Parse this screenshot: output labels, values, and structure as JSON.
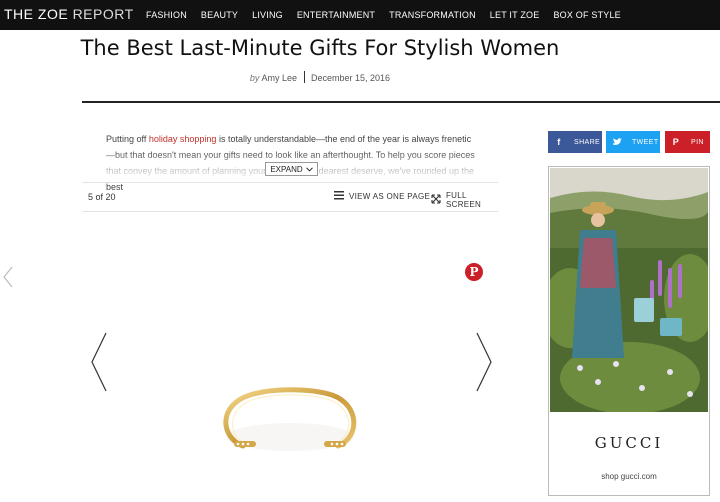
{
  "site": {
    "logo_main": "THE ZOE",
    "logo_sub": "REPORT"
  },
  "nav": {
    "items": [
      "FASHION",
      "BEAUTY",
      "LIVING",
      "ENTERTAINMENT",
      "TRANSFORMATION",
      "LET IT ZOE",
      "BOX OF STYLE"
    ]
  },
  "article": {
    "title": "The Best Last-Minute Gifts For Stylish Women",
    "by": "by",
    "author": "Amy Lee",
    "date": "December 15, 2016",
    "intro_before": "Putting off ",
    "intro_link": "holiday shopping",
    "intro_after": " is totally understandable—the end of the year is always frenetic—but that doesn't mean your gifts need to look like an afterthought. To help you score pieces that convey the amount of planning your nearest and dearest deserve, we've rounded up the best",
    "expand_label": "EXPAND"
  },
  "gallery": {
    "counter": "5 of 20",
    "view_one_page": "VIEW AS ONE PAGE",
    "full_screen": "FULL SCREEN"
  },
  "share": {
    "facebook": "SHARE",
    "twitter": "TWEET",
    "pinterest": "PIN"
  },
  "ad": {
    "brand": "GUCCI",
    "link": "shop gucci.com"
  },
  "colors": {
    "nav_bg": "#111111",
    "link_red": "#c0312a",
    "facebook": "#3b5998",
    "twitter": "#1da1f2",
    "pinterest": "#cb2027"
  }
}
